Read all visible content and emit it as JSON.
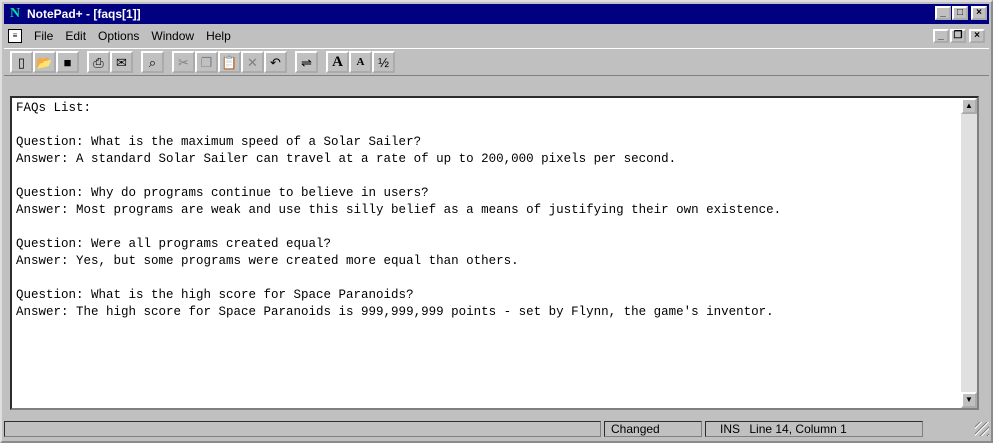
{
  "window": {
    "app_icon": "N",
    "title": "NotePad+ - [faqs[1]]",
    "buttons": {
      "minimize": "_",
      "maximize": "□",
      "close": "×"
    }
  },
  "menu": {
    "items": [
      "File",
      "Edit",
      "Options",
      "Window",
      "Help"
    ],
    "mdi_buttons": {
      "minimize": "_",
      "restore": "❐",
      "close": "×"
    }
  },
  "toolbar": {
    "buttons": [
      {
        "icon": "new-document-icon",
        "glyph": "▯",
        "enabled": true
      },
      {
        "icon": "open-folder-icon",
        "glyph": "📂",
        "enabled": true
      },
      {
        "icon": "save-disk-icon",
        "glyph": "■",
        "enabled": true
      },
      {
        "icon": "print-icon",
        "glyph": "⎙",
        "enabled": true
      },
      {
        "icon": "mail-icon",
        "glyph": "✉",
        "enabled": true
      },
      {
        "icon": "find-binoculars-icon",
        "glyph": "⌕",
        "enabled": true
      },
      {
        "icon": "cut-icon",
        "glyph": "✂",
        "enabled": false
      },
      {
        "icon": "copy-icon",
        "glyph": "❐",
        "enabled": false
      },
      {
        "icon": "paste-icon",
        "glyph": "📋",
        "enabled": false
      },
      {
        "icon": "delete-icon",
        "glyph": "✕",
        "enabled": false
      },
      {
        "icon": "undo-icon",
        "glyph": "↶",
        "enabled": true
      },
      {
        "icon": "word-wrap-icon",
        "glyph": "⇌",
        "enabled": true
      },
      {
        "icon": "font-larger-icon",
        "glyph": "A",
        "enabled": true
      },
      {
        "icon": "font-smaller-icon",
        "glyph": "A",
        "enabled": true
      },
      {
        "icon": "fraction-icon",
        "glyph": "½",
        "enabled": true
      }
    ]
  },
  "editor": {
    "lines": [
      "FAQs List:",
      "",
      "Question: What is the maximum speed of a Solar Sailer?",
      "Answer: A standard Solar Sailer can travel at a rate of up to 200,000 pixels per second.",
      "",
      "Question: Why do programs continue to believe in users?",
      "Answer: Most programs are weak and use this silly belief as a means of justifying their own existence.",
      "",
      "Question: Were all programs created equal?",
      "Answer: Yes, but some programs were created more equal than others.",
      "",
      "Question: What is the high score for Space Paranoids?",
      "Answer: The high score for Space Paranoids is 999,999,999 points - set by Flynn, the game's inventor."
    ]
  },
  "status": {
    "changed": "Changed",
    "mode": "INS",
    "position": "Line 14, Column 1"
  }
}
